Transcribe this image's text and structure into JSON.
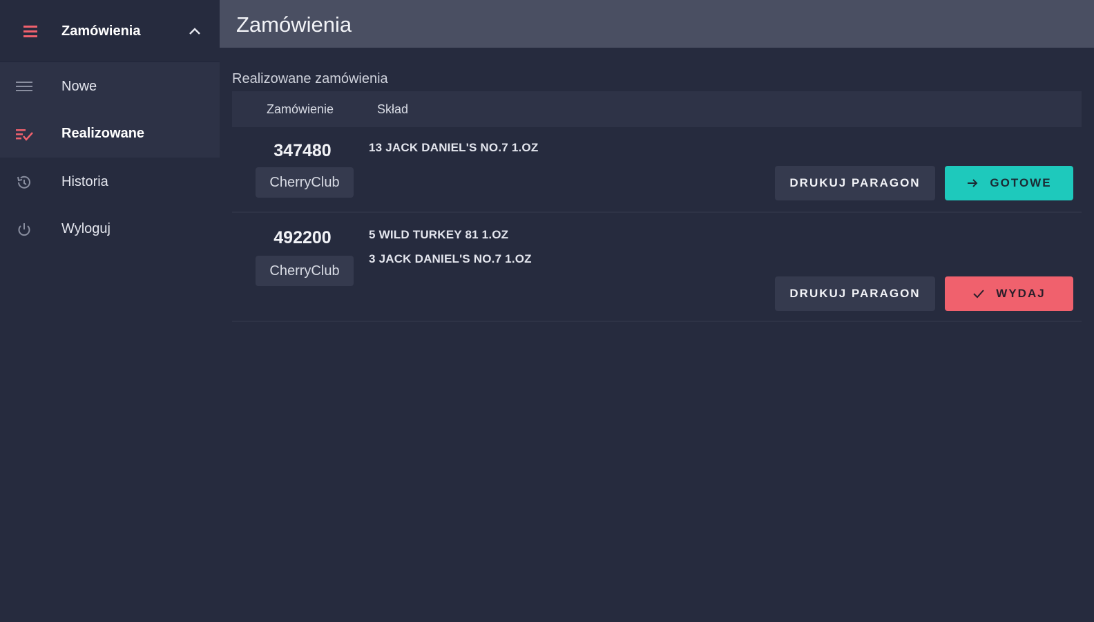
{
  "sidebar": {
    "header": {
      "title": "Zamówienia",
      "icon": "hamburger-menu-icon"
    },
    "items": [
      {
        "label": "Nowe",
        "icon": "list-icon"
      },
      {
        "label": "Realizowane",
        "icon": "list-check-icon",
        "active": true
      },
      {
        "label": "Historia",
        "icon": "history-icon"
      },
      {
        "label": "Wyloguj",
        "icon": "power-icon"
      }
    ]
  },
  "topbar": {
    "title": "Zamówienia"
  },
  "main": {
    "section_title": "Realizowane zamówienia",
    "columns": [
      "Zamówienie",
      "Skład"
    ],
    "orders": [
      {
        "number": "347480",
        "club": "CherryClub",
        "items": [
          "13 JACK DANIEL'S NO.7 1.OZ"
        ],
        "print_label": "DRUKUJ PARAGON",
        "action_label": "GOTOWE",
        "action_icon": "arrow-right-icon"
      },
      {
        "number": "492200",
        "club": "CherryClub",
        "items": [
          "5 WILD TURKEY 81 1.OZ",
          "3 JACK DANIEL'S NO.7 1.OZ"
        ],
        "print_label": "DRUKUJ PARAGON",
        "action_label": "WYDAJ",
        "action_icon": "checkmark-icon"
      }
    ]
  },
  "colors": {
    "accent_red": "#f0616d",
    "accent_teal": "#1ec9bc",
    "background": "#262b3e",
    "topbar": "#4a4f62"
  }
}
